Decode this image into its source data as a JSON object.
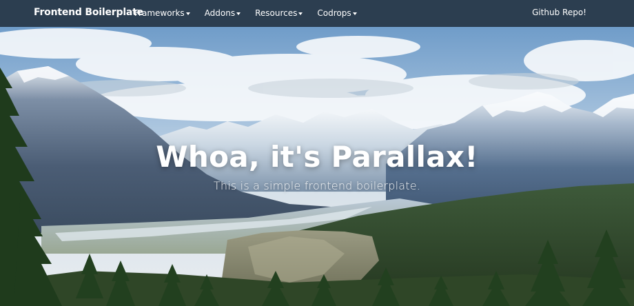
{
  "navbar": {
    "brand": "Frontend Boilerplate",
    "menu": [
      {
        "label": "Frameworks",
        "has_dropdown": true
      },
      {
        "label": "Addons",
        "has_dropdown": true
      },
      {
        "label": "Resources",
        "has_dropdown": true
      },
      {
        "label": "Codrops",
        "has_dropdown": true
      }
    ],
    "right_link": "Github Repo!",
    "background_color": "#2c3e50"
  },
  "hero": {
    "title": "Whoa, it's Parallax!",
    "subtitle": "This is a simple frontend boilerplate."
  }
}
